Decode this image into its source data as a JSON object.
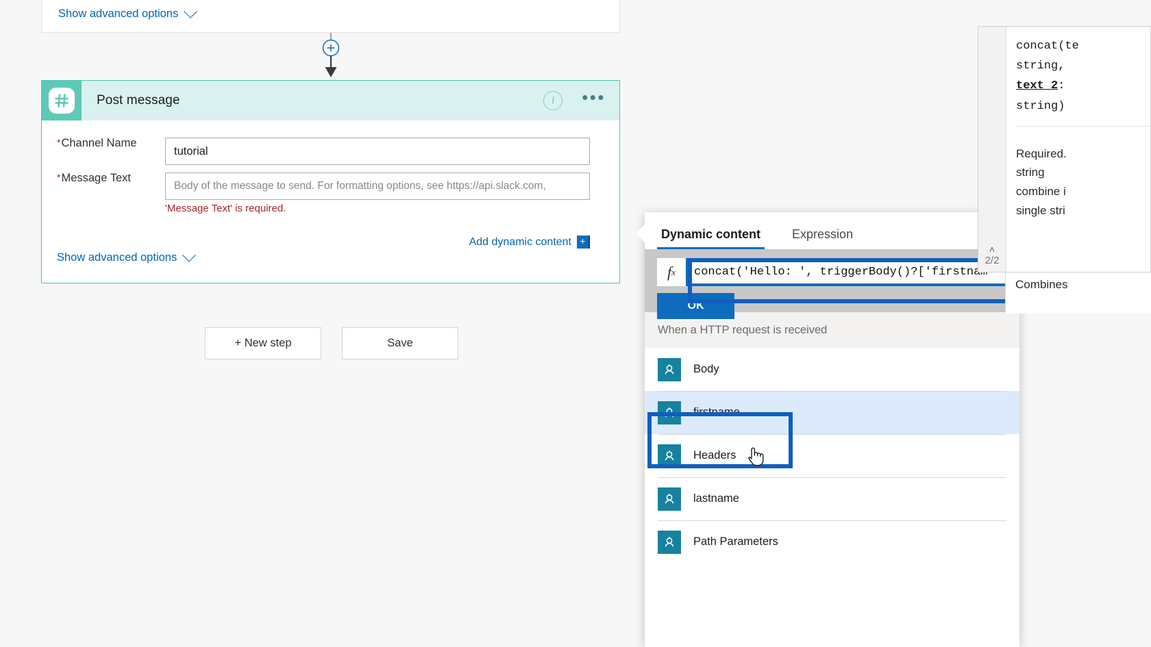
{
  "previous_action": {
    "show_advanced_label": "Show advanced options"
  },
  "connector": {
    "add_step_icon": "plus-in-circle"
  },
  "action_card": {
    "icon": "slack-hash-icon",
    "title": "Post message",
    "info_icon": "i",
    "more_menu": "•••",
    "fields": [
      {
        "label": "Channel Name",
        "required_marker": "*",
        "value": "tutorial",
        "type": "combobox"
      },
      {
        "label": "Message Text",
        "required_marker": "*",
        "placeholder": "Body of the message to send. For formatting options, see https://api.slack.com,",
        "value": "",
        "type": "textbox",
        "error": "'Message Text' is required."
      }
    ],
    "add_dynamic_content_label": "Add dynamic content",
    "add_dynamic_content_badge": "+",
    "show_advanced_label": "Show advanced options"
  },
  "workflow_buttons": {
    "new_step": "+ New step",
    "save": "Save"
  },
  "flyout": {
    "tabs": [
      {
        "label": "Dynamic content",
        "active": true
      },
      {
        "label": "Expression",
        "active": false
      }
    ],
    "expression": {
      "fx_label": "fx",
      "value": "concat('Hello: ', triggerBody()?['firstnam",
      "ok_label": "OK"
    },
    "group_header": "When a HTTP request is received",
    "items": [
      {
        "label": "Body",
        "icon": "trigger-output-icon",
        "selected": false
      },
      {
        "label": "firstname",
        "icon": "trigger-output-icon",
        "selected": true
      },
      {
        "label": "Headers",
        "icon": "trigger-output-icon",
        "selected": false
      },
      {
        "label": "lastname",
        "icon": "trigger-output-icon",
        "selected": false
      },
      {
        "label": "Path Parameters",
        "icon": "trigger-output-icon",
        "selected": false
      }
    ]
  },
  "doc_tooltip": {
    "signature": "concat(te\nstring,\n",
    "param_current": "text_2",
    "signature_tail": ":\nstring)",
    "description": "Required.\nstring\ncombine i\nsingle stri",
    "extra": "Combines",
    "pager": "2/2",
    "pager_caret": "˄"
  },
  "colors": {
    "accent": "#0f6cbd",
    "slack_teal": "#5ec9b7",
    "card_header": "#d9f2ef",
    "error": "#a4262c",
    "link": "#0065b3",
    "dc_icon": "#1682a0",
    "selection_outline": "#0f5fbf"
  }
}
